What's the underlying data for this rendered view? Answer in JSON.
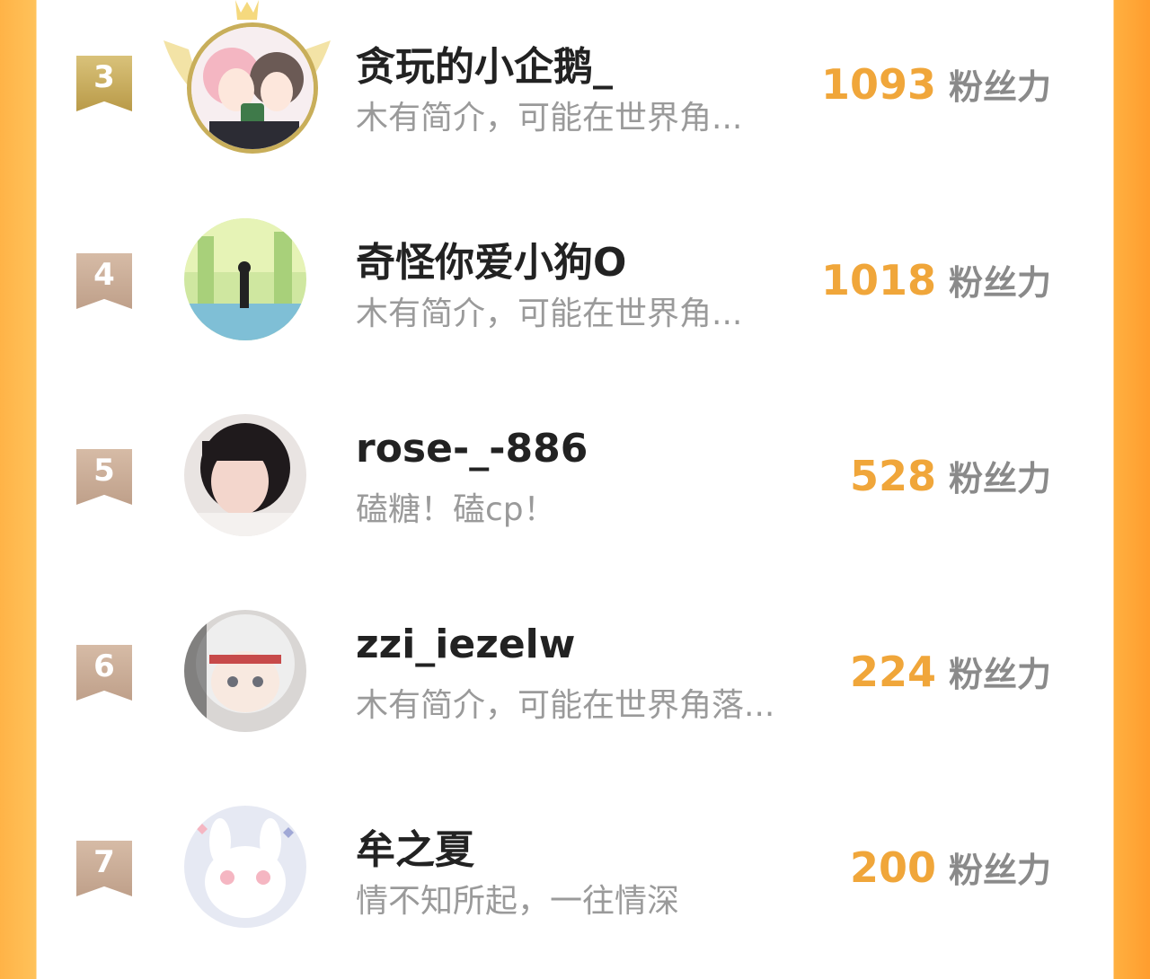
{
  "leaderboard": {
    "score_unit": "粉丝力",
    "entries": [
      {
        "rank": "3",
        "name": "贪玩的小企鹅_",
        "bio": "木有简介，可能在世界角...",
        "score": "1093",
        "avatar_icon": "avatar-anime-girls",
        "badge": "gold",
        "crowned": true
      },
      {
        "rank": "4",
        "name": "奇怪你爱小狗O",
        "bio": "木有简介，可能在世界角...",
        "score": "1018",
        "avatar_icon": "avatar-green-forest",
        "badge": "plain",
        "crowned": false
      },
      {
        "rank": "5",
        "name": "rose-_-886",
        "bio": "磕糖！磕cp！",
        "score": "528",
        "avatar_icon": "avatar-girl-photo",
        "badge": "plain",
        "crowned": false
      },
      {
        "rank": "6",
        "name": "zzi_iezelw",
        "bio": "木有简介，可能在世界角落...",
        "score": "224",
        "avatar_icon": "avatar-plush-doll",
        "badge": "plain",
        "crowned": false
      },
      {
        "rank": "7",
        "name": "牟之夏",
        "bio": "情不知所起，一往情深",
        "score": "200",
        "avatar_icon": "avatar-cartoon-bunny",
        "badge": "plain",
        "crowned": false
      }
    ]
  },
  "colors": {
    "accent": "#f0a63a",
    "gold_badge": "#c8a95a",
    "plain_badge": "#cfb29c",
    "side_orange": "#ffa83a"
  }
}
